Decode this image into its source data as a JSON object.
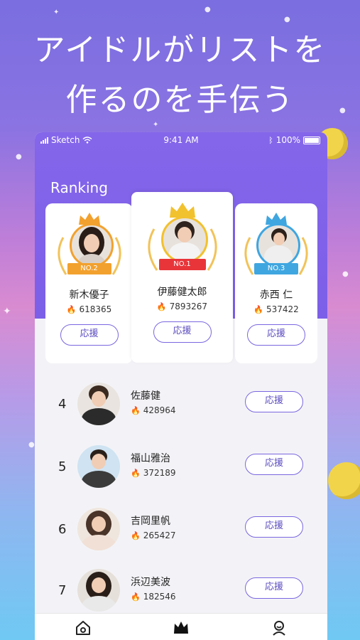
{
  "headline": {
    "line1": "アイドルがリストを",
    "line2": "作るのを手伝う"
  },
  "status_bar": {
    "carrier": "Sketch",
    "time": "9:41 AM",
    "battery": "100%"
  },
  "section_title": "Ranking",
  "cheer_label": "応援",
  "podium": [
    {
      "badge": "NO.2",
      "name": "新木優子",
      "score": "618365",
      "accent": "#f2a12e"
    },
    {
      "badge": "NO.1",
      "name": "伊藤健太郎",
      "score": "7893267",
      "accent": "#e8353a"
    },
    {
      "badge": "NO.3",
      "name": "赤西 仁",
      "score": "537422",
      "accent": "#3fa6e0"
    }
  ],
  "ranking_list": [
    {
      "rank": "4",
      "name": "佐藤健",
      "score": "428964"
    },
    {
      "rank": "5",
      "name": "福山雅治",
      "score": "372189"
    },
    {
      "rank": "6",
      "name": "吉岡里帆",
      "score": "265427"
    },
    {
      "rank": "7",
      "name": "浜辺美波",
      "score": "182546"
    }
  ],
  "tabs": [
    {
      "icon": "home-icon",
      "active": false
    },
    {
      "icon": "crown-icon",
      "active": true
    },
    {
      "icon": "profile-icon",
      "active": false
    }
  ],
  "colors": {
    "primary": "#7c5fe8",
    "flame": "#f05a3a",
    "gold": "#f2c12e"
  }
}
